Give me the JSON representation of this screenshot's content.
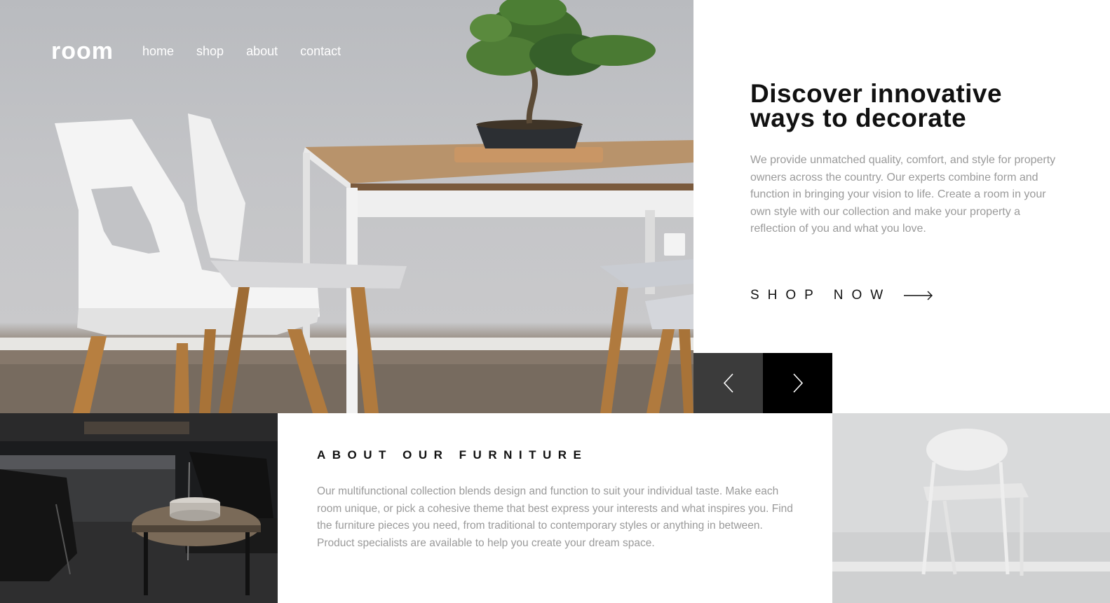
{
  "nav": {
    "logo": "room",
    "links": [
      "home",
      "shop",
      "about",
      "contact"
    ]
  },
  "hero": {
    "title_line1": "Discover innovative",
    "title_line2": "ways to decorate",
    "description": "We provide unmatched quality, comfort, and style for property owners across the country. Our experts combine form and function in bringing your vision to life. Create a room in your own style with our collection and make your property a reflection of you and what you love.",
    "cta_label": "SHOP NOW",
    "cta_icon": "arrow-right-icon"
  },
  "slider": {
    "prev_icon": "chevron-left-icon",
    "next_icon": "chevron-right-icon"
  },
  "about": {
    "title": "ABOUT OUR FURNITURE",
    "text": "Our multifunctional collection blends design and function to suit your individual taste. Make each room unique, or pick a cohesive theme that best express your interests and what inspires you. Find the furniture pieces you need, from traditional to contemporary styles or anything in between. Product specialists are available to help you create your dream space."
  },
  "colors": {
    "text_dark": "#111111",
    "text_muted": "#9a9a9a",
    "prev_bg": "#3b3b3b",
    "next_bg": "#000000"
  }
}
